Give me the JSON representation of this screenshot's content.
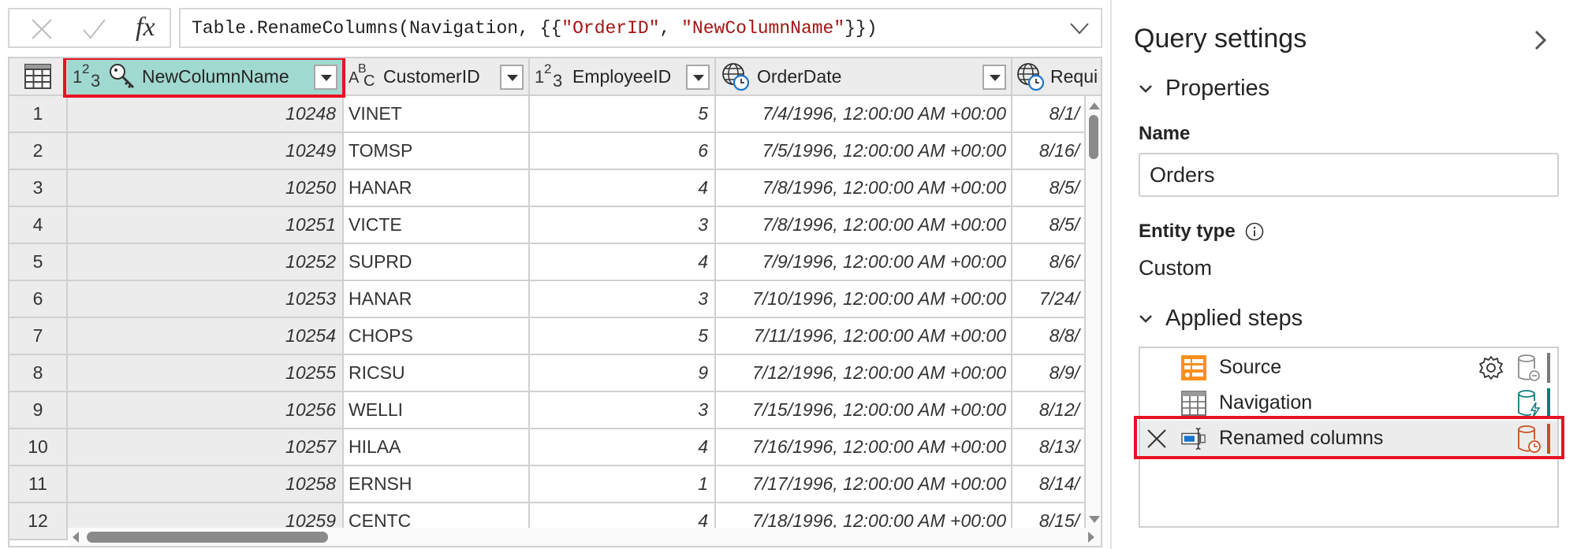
{
  "formula_bar": {
    "fx_label": "fx",
    "formula_prefix": "Table.RenameColumns(Navigation, {{",
    "arg1": "\"OrderID\"",
    "sep": ", ",
    "arg2": "\"NewColumnName\"",
    "formula_suffix": "}})",
    "string_color": "#a31515"
  },
  "grid": {
    "columns": [
      {
        "name": "NewColumnName",
        "type": "number",
        "key": true,
        "selected": true
      },
      {
        "name": "CustomerID",
        "type": "text"
      },
      {
        "name": "EmployeeID",
        "type": "number"
      },
      {
        "name": "OrderDate",
        "type": "datetimezone"
      },
      {
        "name": "Requi",
        "type": "datetimezone"
      }
    ],
    "rows": [
      {
        "n": "1",
        "id": "10248",
        "cust": "VINET",
        "emp": "5",
        "date": "7/4/1996, 12:00:00 AM +00:00",
        "req": "8/1/"
      },
      {
        "n": "2",
        "id": "10249",
        "cust": "TOMSP",
        "emp": "6",
        "date": "7/5/1996, 12:00:00 AM +00:00",
        "req": "8/16/"
      },
      {
        "n": "3",
        "id": "10250",
        "cust": "HANAR",
        "emp": "4",
        "date": "7/8/1996, 12:00:00 AM +00:00",
        "req": "8/5/"
      },
      {
        "n": "4",
        "id": "10251",
        "cust": "VICTE",
        "emp": "3",
        "date": "7/8/1996, 12:00:00 AM +00:00",
        "req": "8/5/"
      },
      {
        "n": "5",
        "id": "10252",
        "cust": "SUPRD",
        "emp": "4",
        "date": "7/9/1996, 12:00:00 AM +00:00",
        "req": "8/6/"
      },
      {
        "n": "6",
        "id": "10253",
        "cust": "HANAR",
        "emp": "3",
        "date": "7/10/1996, 12:00:00 AM +00:00",
        "req": "7/24/"
      },
      {
        "n": "7",
        "id": "10254",
        "cust": "CHOPS",
        "emp": "5",
        "date": "7/11/1996, 12:00:00 AM +00:00",
        "req": "8/8/"
      },
      {
        "n": "8",
        "id": "10255",
        "cust": "RICSU",
        "emp": "9",
        "date": "7/12/1996, 12:00:00 AM +00:00",
        "req": "8/9/"
      },
      {
        "n": "9",
        "id": "10256",
        "cust": "WELLI",
        "emp": "3",
        "date": "7/15/1996, 12:00:00 AM +00:00",
        "req": "8/12/"
      },
      {
        "n": "10",
        "id": "10257",
        "cust": "HILAA",
        "emp": "4",
        "date": "7/16/1996, 12:00:00 AM +00:00",
        "req": "8/13/"
      },
      {
        "n": "11",
        "id": "10258",
        "cust": "ERNSH",
        "emp": "1",
        "date": "7/17/1996, 12:00:00 AM +00:00",
        "req": "8/14/"
      },
      {
        "n": "12",
        "id": "10259",
        "cust": "CENTC",
        "emp": "4",
        "date": "7/18/1996, 12:00:00 AM +00:00",
        "req": "8/15/"
      }
    ],
    "selected_header_color": "#a0d9d0",
    "highlight_color": "#e81123"
  },
  "query_settings": {
    "title": "Query settings",
    "properties_label": "Properties",
    "name_label": "Name",
    "name_value": "Orders",
    "entity_type_label": "Entity type",
    "entity_type_value": "Custom",
    "applied_steps_label": "Applied steps",
    "steps": [
      {
        "label": "Source",
        "icon": "source-icon",
        "has_settings": true,
        "indicator_color": "#7a7a7a"
      },
      {
        "label": "Navigation",
        "icon": "table-icon",
        "has_settings": false,
        "indicator_color": "#0f7b7b"
      },
      {
        "label": "Renamed columns",
        "icon": "rename-columns-icon",
        "has_settings": false,
        "indicator_color": "#c8501e",
        "active": true
      }
    ]
  }
}
